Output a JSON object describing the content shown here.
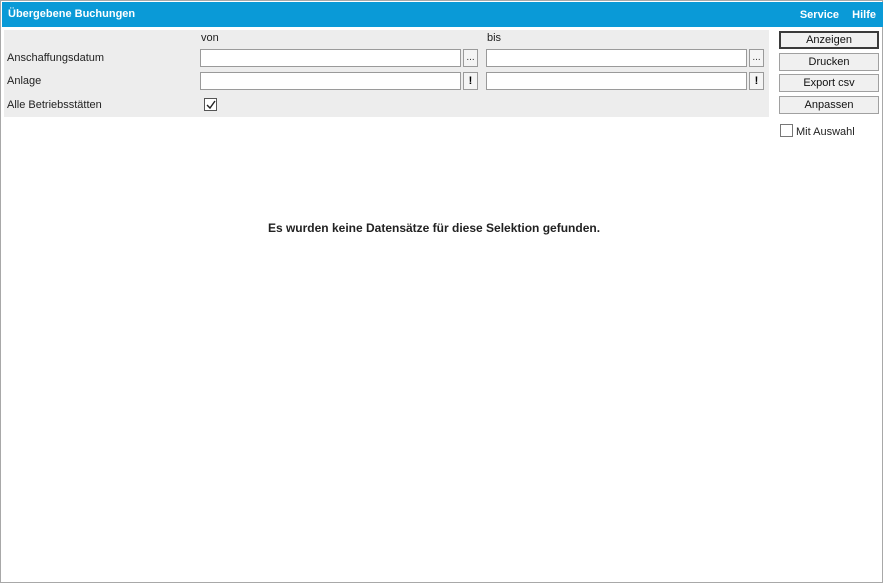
{
  "window": {
    "title": "Übergebene Buchungen",
    "menu": [
      {
        "label": "Service"
      },
      {
        "label": "Hilfe"
      }
    ]
  },
  "filter": {
    "col_von": "von",
    "col_bis": "bis",
    "rows": {
      "anschaffungsdatum": {
        "label": "Anschaffungsdatum",
        "von_value": "",
        "bis_value": "",
        "picker_glyph": "..."
      },
      "anlage": {
        "label": "Anlage",
        "von_value": "",
        "bis_value": "",
        "lookup_glyph": "!"
      },
      "betriebsstaetten": {
        "label": "Alle Betriebsstätten",
        "checked": true
      }
    }
  },
  "actions": {
    "anzeigen": "Anzeigen",
    "drucken": "Drucken",
    "export_csv": "Export csv",
    "anpassen": "Anpassen",
    "mit_auswahl": {
      "label": "Mit Auswahl",
      "checked": false
    }
  },
  "result": {
    "message": "Es wurden keine Datensätze für diese Selektion gefunden."
  },
  "colors": {
    "titlebar": "#0a9ad7",
    "panel": "#ededed"
  }
}
